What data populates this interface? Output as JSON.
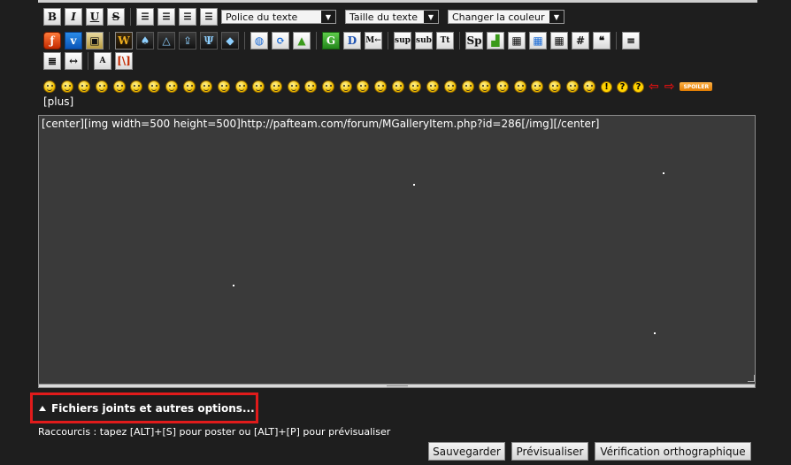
{
  "toolbar": {
    "format_buttons": [
      "B",
      "I",
      "U",
      "S"
    ],
    "align_buttons": [
      "align-left",
      "align-center",
      "align-right",
      "justify"
    ],
    "font_select": "Police du texte",
    "size_select": "Taille du texte",
    "color_select": "Changer la couleur",
    "row2_buttons": [
      "flash",
      "vimeo",
      "dailymotion",
      "wow",
      "icon-a",
      "icon-b",
      "icon-c",
      "icon-d",
      "icon-e",
      "globe",
      "refresh",
      "image-upload",
      "G",
      "D",
      "M←",
      "sup",
      "sub",
      "Tt",
      "Sp",
      "image",
      "table",
      "table-blue",
      "table-small",
      "#",
      "quote",
      "list"
    ],
    "row3_buttons": [
      "numbered-list",
      "horizontal-rule",
      "font-size",
      "html"
    ],
    "labels": {
      "sup": "sup",
      "sub": "sub",
      "Tt": "Tt",
      "Sp": "Sp",
      "G": "G",
      "D": "D",
      "M": "M←",
      "hash": "#"
    }
  },
  "smileys": {
    "count": 32,
    "extra": [
      "!",
      "?",
      "?"
    ],
    "spoiler_label": "SPOILER"
  },
  "plus_link": "[plus]",
  "editor": {
    "content": "[center][img width=500 height=500]http://pafteam.com/forum/MGalleryItem.php?id=286[/img][/center]"
  },
  "attachments": {
    "label": "Fichiers joints et autres options..."
  },
  "shortcuts_text": "Raccourcis : tapez [ALT]+[S] pour poster ou [ALT]+[P] pour prévisualiser",
  "buttons": {
    "save": "Sauvegarder",
    "preview": "Prévisualiser",
    "spellcheck": "Vérification orthographique"
  },
  "colors": {
    "background": "#1e1e1e",
    "editor_bg": "#3a3a3a",
    "highlight": "#e01b1b"
  }
}
